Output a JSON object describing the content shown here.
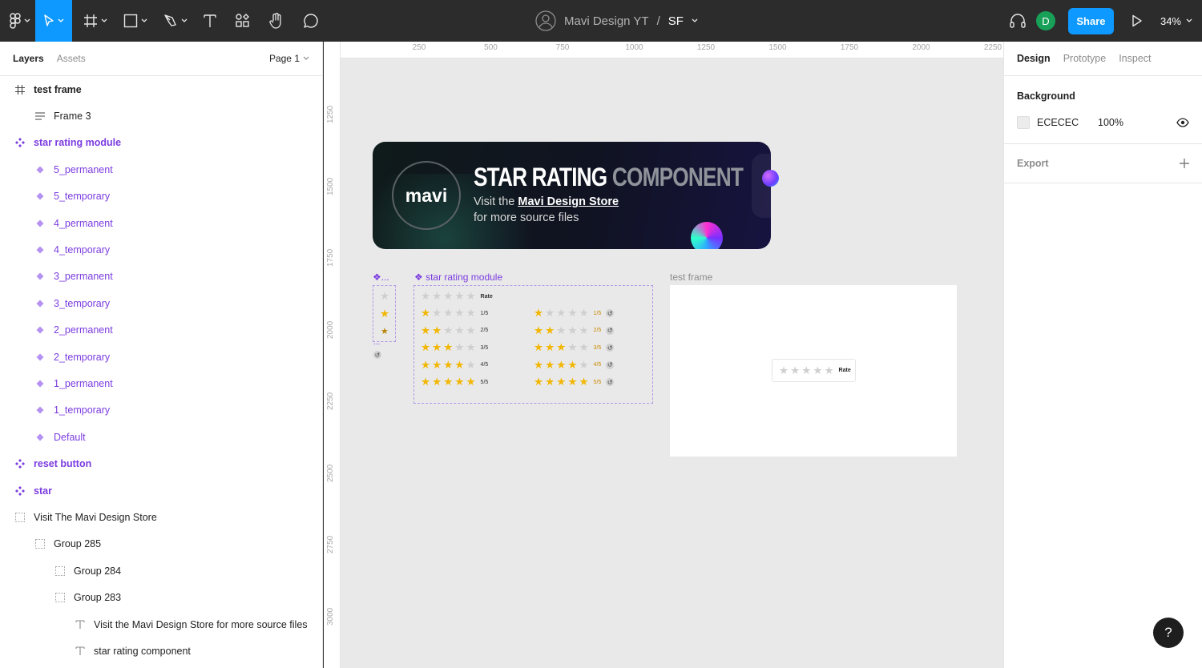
{
  "toolbar": {
    "project": "Mavi Design YT",
    "separator": "/",
    "file": "SF",
    "avatar_letter": "D",
    "share_label": "Share",
    "zoom": "34%"
  },
  "left_panel": {
    "tabs": [
      {
        "label": "Layers"
      },
      {
        "label": "Assets"
      }
    ],
    "page": "Page 1",
    "layers": [
      {
        "label": "test frame",
        "icon": "frame-icon",
        "indent": 0,
        "style": "bold"
      },
      {
        "label": "Frame 3",
        "icon": "auto-layout-icon",
        "indent": 1,
        "style": "normal"
      },
      {
        "label": "star rating module",
        "icon": "component-set-icon",
        "indent": 0,
        "style": "purple-bold"
      },
      {
        "label": "5_permanent",
        "icon": "variant-icon",
        "indent": 1,
        "style": "purple"
      },
      {
        "label": "5_temporary",
        "icon": "variant-icon",
        "indent": 1,
        "style": "purple"
      },
      {
        "label": "4_permanent",
        "icon": "variant-icon",
        "indent": 1,
        "style": "purple"
      },
      {
        "label": "4_temporary",
        "icon": "variant-icon",
        "indent": 1,
        "style": "purple"
      },
      {
        "label": "3_permanent",
        "icon": "variant-icon",
        "indent": 1,
        "style": "purple"
      },
      {
        "label": "3_temporary",
        "icon": "variant-icon",
        "indent": 1,
        "style": "purple"
      },
      {
        "label": "2_permanent",
        "icon": "variant-icon",
        "indent": 1,
        "style": "purple"
      },
      {
        "label": "2_temporary",
        "icon": "variant-icon",
        "indent": 1,
        "style": "purple"
      },
      {
        "label": "1_permanent",
        "icon": "variant-icon",
        "indent": 1,
        "style": "purple"
      },
      {
        "label": "1_temporary",
        "icon": "variant-icon",
        "indent": 1,
        "style": "purple"
      },
      {
        "label": "Default",
        "icon": "variant-icon",
        "indent": 1,
        "style": "purple"
      },
      {
        "label": "reset button",
        "icon": "component-set-icon",
        "indent": 0,
        "style": "purple-bold"
      },
      {
        "label": "star",
        "icon": "component-set-icon",
        "indent": 0,
        "style": "purple-bold"
      },
      {
        "label": "Visit The Mavi Design Store",
        "icon": "group-icon",
        "indent": 0,
        "style": "normal"
      },
      {
        "label": "Group 285",
        "icon": "group-icon",
        "indent": 1,
        "style": "normal"
      },
      {
        "label": "Group 284",
        "icon": "group-icon",
        "indent": 2,
        "style": "normal"
      },
      {
        "label": "Group 283",
        "icon": "group-icon",
        "indent": 2,
        "style": "normal"
      },
      {
        "label": "Visit the Mavi Design Store for more source files",
        "icon": "text-icon",
        "indent": 3,
        "style": "normal"
      },
      {
        "label": "star rating component",
        "icon": "text-icon",
        "indent": 3,
        "style": "normal"
      }
    ]
  },
  "canvas": {
    "ruler_top": [
      "250",
      "500",
      "750",
      "1000",
      "1250",
      "1500",
      "1750",
      "2000",
      "2250"
    ],
    "ruler_left": [
      "1250",
      "1500",
      "1750",
      "2000",
      "2250",
      "2500",
      "2750",
      "3000"
    ],
    "banner": {
      "logo_text": "mavi",
      "title_white": "STAR RATING",
      "title_grey": "COMPONENT",
      "sub_prefix": "Visit the",
      "sub_link": "Mavi Design Store",
      "sub_line2": "for more source files"
    },
    "star_label": "❖...",
    "star_more": "...",
    "module_label": "❖ star rating module",
    "test_frame_label": "test frame",
    "rate_label": "Rate",
    "rows_left": [
      {
        "filled": 0,
        "label": "Rate"
      },
      {
        "filled": 1,
        "label": "1/5"
      },
      {
        "filled": 2,
        "label": "2/5"
      },
      {
        "filled": 3,
        "label": "3/5"
      },
      {
        "filled": 4,
        "label": "4/5"
      },
      {
        "filled": 5,
        "label": "5/5"
      }
    ],
    "rows_right": [
      {
        "filled": 1,
        "label": "1/5"
      },
      {
        "filled": 2,
        "label": "2/5"
      },
      {
        "filled": 3,
        "label": "3/5"
      },
      {
        "filled": 4,
        "label": "4/5"
      },
      {
        "filled": 5,
        "label": "5/5"
      }
    ]
  },
  "right_panel": {
    "tabs": [
      {
        "label": "Design"
      },
      {
        "label": "Prototype"
      },
      {
        "label": "Inspect"
      }
    ],
    "background_heading": "Background",
    "bg_hex": "ECECEC",
    "bg_opacity": "100%",
    "export_heading": "Export"
  },
  "help_label": "?",
  "colors": {
    "accent": "#0d99ff",
    "component_purple": "#7b3ce0",
    "star_on": "#f2b705",
    "star_off": "#cfcfcf"
  }
}
